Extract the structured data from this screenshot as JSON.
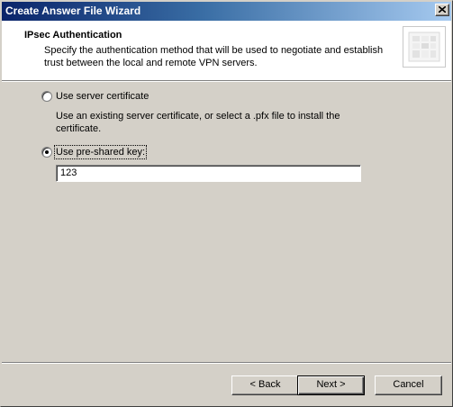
{
  "window": {
    "title": "Create Answer File Wizard"
  },
  "header": {
    "title": "IPsec Authentication",
    "description": "Specify the authentication method that will be used to negotiate and establish trust between the local and remote VPN servers."
  },
  "options": [
    {
      "label": "Use server certificate",
      "description": "Use an existing server certificate, or select a .pfx file to install the certificate.",
      "selected": false
    },
    {
      "label": "Use pre-shared key:",
      "selected": true
    }
  ],
  "preshared_key": {
    "value": "123"
  },
  "buttons": {
    "back": "< Back",
    "next": "Next >",
    "cancel": "Cancel"
  }
}
